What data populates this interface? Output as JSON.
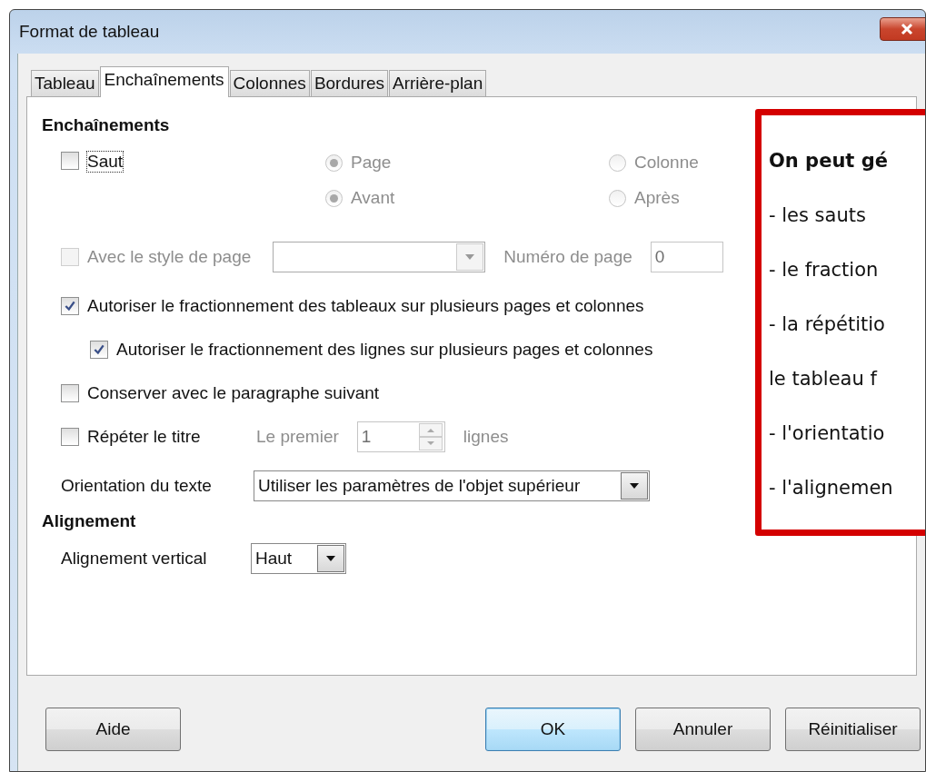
{
  "window": {
    "title": "Format de tableau"
  },
  "tabs": [
    {
      "label": "Tableau",
      "selected": false
    },
    {
      "label": "Enchaînements",
      "selected": true
    },
    {
      "label": "Colonnes",
      "selected": false
    },
    {
      "label": "Bordures",
      "selected": false
    },
    {
      "label": "Arrière-plan",
      "selected": false
    }
  ],
  "flow": {
    "heading": "Enchaînements",
    "break": {
      "label": "Saut",
      "checked": false,
      "disabled": false
    },
    "break_type": [
      {
        "label": "Page",
        "selected": true,
        "disabled": true
      },
      {
        "label": "Colonne",
        "selected": false,
        "disabled": true
      }
    ],
    "break_position": [
      {
        "label": "Avant",
        "selected": true,
        "disabled": true
      },
      {
        "label": "Après",
        "selected": false,
        "disabled": true
      }
    ],
    "page_style": {
      "label": "Avec le style de page",
      "checked": false,
      "disabled": true
    },
    "page_number": {
      "label": "Numéro de page",
      "value": "0",
      "disabled": true
    },
    "options": [
      {
        "label": "Autoriser le fractionnement des tableaux sur plusieurs pages et colonnes",
        "checked": true,
        "disabled": false,
        "children": [
          {
            "label": "Autoriser le fractionnement des lignes sur plusieurs pages et colonnes",
            "checked": true,
            "disabled": false
          }
        ]
      },
      {
        "label": "Conserver avec le paragraphe suivant",
        "checked": false,
        "disabled": false
      }
    ],
    "repeat_heading": {
      "label": "Répéter le titre",
      "checked": false,
      "disabled": false,
      "first_label": "Le premier",
      "value": "1",
      "unit": "lignes",
      "spin_disabled": true
    },
    "orientation": {
      "label": "Orientation du texte",
      "value": "Utiliser les paramètres de l'objet supérieur"
    }
  },
  "alignment": {
    "heading": "Alignement",
    "label": "Alignement vertical",
    "value": "Haut"
  },
  "buttons": [
    {
      "label": "Aide",
      "focused": false
    },
    {
      "label": "OK",
      "focused": true
    },
    {
      "label": "Annuler",
      "focused": false
    },
    {
      "label": "Réinitialiser",
      "focused": false
    }
  ],
  "callout": {
    "lines": [
      {
        "text": "On peut gé",
        "bold": true
      },
      {
        "text": "- les sauts",
        "bold": false
      },
      {
        "text": "- le fraction",
        "bold": false
      },
      {
        "text": "- la répétitio",
        "bold": false
      },
      {
        "text": "le tableau f",
        "bold": false
      },
      {
        "text": "- l'orientatio",
        "bold": false
      },
      {
        "text": "- l'alignemen",
        "bold": false
      }
    ]
  }
}
